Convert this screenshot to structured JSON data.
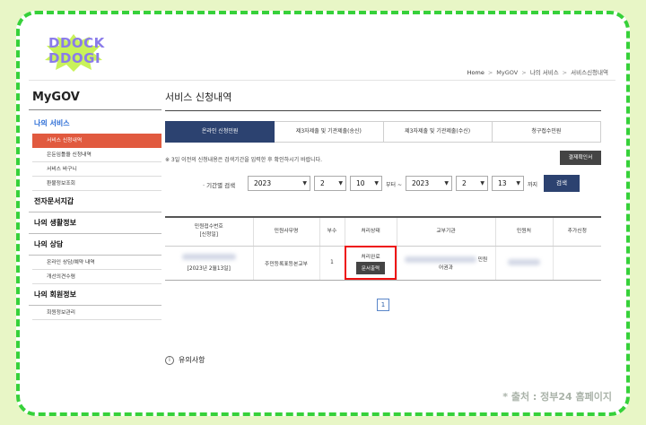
{
  "logo": {
    "line1": "DDOCK",
    "line2": "DDOGI"
  },
  "breadcrumb": [
    "Home",
    "MyGOV",
    "나의 서비스",
    "서비스신청내역"
  ],
  "sidebar": {
    "title": "MyGOV",
    "group_active": "나의 서비스",
    "service_items": [
      "서비스 신청내역",
      "은둔임틀을 신청내역",
      "서비스 바구니",
      "환불정보조회"
    ],
    "heads": [
      "전자문서지갑",
      "나의 생활정보",
      "나의 상담"
    ],
    "consult_items": [
      "온라인 상담/예약 내역",
      "개선의견수렴"
    ],
    "member_head": "나의 회원정보",
    "member_items": [
      "회원정보관리"
    ]
  },
  "main": {
    "title": "서비스 신청내역",
    "tabs": [
      "온라인 신청민원",
      "제3자제출 및 기관제출(송신)",
      "제3자제출 및 기관제출(수신)",
      "청구접수민원"
    ],
    "note": "※ 3일 이전의 신청내용은 검색기간을 입력한 후 확인하시기 바랍니다.",
    "receipt_button": "결제확인서",
    "search": {
      "label": "· 기간별 검색",
      "from_year": "2023",
      "from_month": "2",
      "from_day": "10",
      "between": "부터 ~",
      "to_year": "2023",
      "to_month": "2",
      "to_day": "13",
      "until": "까지",
      "button": "검색"
    },
    "table": {
      "headers": [
        "민원접수번호\n[신청일]",
        "민원사무명",
        "부수",
        "처리상태",
        "교부기관",
        "민원처",
        "추가신청"
      ],
      "row": {
        "date": "[2023년 2월13일]",
        "service": "주민등록표등본교부",
        "copies": "1",
        "status": "처리완료",
        "doc_button": "문서출력",
        "agency_suffix": "민원",
        "agency_line2": "어권과"
      }
    },
    "pager": [
      "1"
    ]
  },
  "notice": "유의사항",
  "credit": "* 출처 : 정부24 홈페이지",
  "colors": {
    "accent": "#e15a3f",
    "navy": "#2c4270",
    "frame_green": "#36d13a",
    "highlight": "#e11111"
  }
}
